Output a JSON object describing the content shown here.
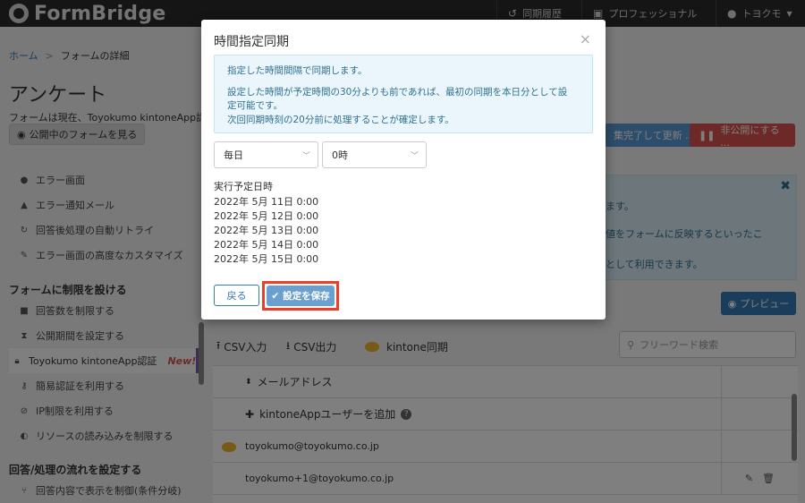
{
  "topbar": {
    "logo_text": "FormBridge",
    "sync_history": "同期履歴",
    "plan": "プロフェッショナル",
    "user": "トヨクモ"
  },
  "breadcrumb": {
    "home": "ホーム",
    "separator": ">",
    "current": "フォームの詳細"
  },
  "page": {
    "title": "アンケート",
    "status_text": "フォームは現在、Toyokumo kintoneApp認証",
    "view_form_button": "公開中のフォームを見る",
    "update_button": "集完了して更新 ...",
    "unpublish_button": "非公開にする ..."
  },
  "sidebar": {
    "items_top": [
      {
        "icon": "info-icon",
        "label": "エラー画面"
      },
      {
        "icon": "bell-icon",
        "label": "エラー通知メール"
      },
      {
        "icon": "refresh-icon",
        "label": "回答後処理の自動リトライ"
      },
      {
        "icon": "wrench-icon",
        "label": "エラー画面の高度なカスタマイズ"
      }
    ],
    "section_restrict": "フォームに制限を設ける",
    "items_restrict": [
      {
        "icon": "briefcase-icon",
        "label": "回答数を制限する"
      },
      {
        "icon": "hourglass-icon",
        "label": "公開期間を設定する"
      },
      {
        "icon": "lock-icon",
        "label": "Toyokumo kintoneApp認証",
        "badge": "New!"
      },
      {
        "icon": "key-icon",
        "label": "簡易認証を利用する"
      },
      {
        "icon": "ban-icon",
        "label": "IP制限を利用する"
      },
      {
        "icon": "shield-icon",
        "label": "リソースの読み込みを制限する"
      }
    ],
    "section_flow": "回答/処理の流れを設定する",
    "items_flow": [
      {
        "icon": "branch-icon",
        "label": "回答内容で表示を制御(条件分岐)"
      }
    ]
  },
  "info_panel": {
    "lines": [
      "ます。",
      "値をフォームに反映するといったこ",
      "として利用できます。"
    ]
  },
  "preview_button": "プレビュー",
  "toolbar": {
    "csv_import": "CSV入力",
    "csv_export": "CSV出力",
    "kintone_sync": "kintone同期",
    "search_placeholder": "フリーワード検索"
  },
  "table": {
    "header_email": "メールアドレス",
    "add_user": "kintoneAppユーザーを追加",
    "rows": [
      "toyokumo@toyokumo.co.jp",
      "toyokumo+1@toyokumo.co.jp"
    ]
  },
  "modal": {
    "title": "時間指定同期",
    "notice_lines": [
      "指定した時間間隔で同期します。",
      "設定した時間が予定時間の30分よりも前であれば、最初の同期を本日分として設",
      "定可能です。",
      "次回同期時刻の20分前に処理することが確定します。"
    ],
    "frequency_value": "毎日",
    "hour_value": "0時",
    "exec_label": "実行予定日時",
    "dates": [
      "2022年 5月 11日 0:00",
      "2022年 5月 12日 0:00",
      "2022年 5月 13日 0:00",
      "2022年 5月 14日 0:00",
      "2022年 5月 15日 0:00"
    ],
    "back_button": "戻る",
    "save_button": "設定を保存"
  },
  "colors": {
    "primary": "#337ab7",
    "save_button": "#6aa0cf",
    "highlight": "#e8402a",
    "notice_bg": "#eaf6fb",
    "unpublish": "#d9534f"
  }
}
